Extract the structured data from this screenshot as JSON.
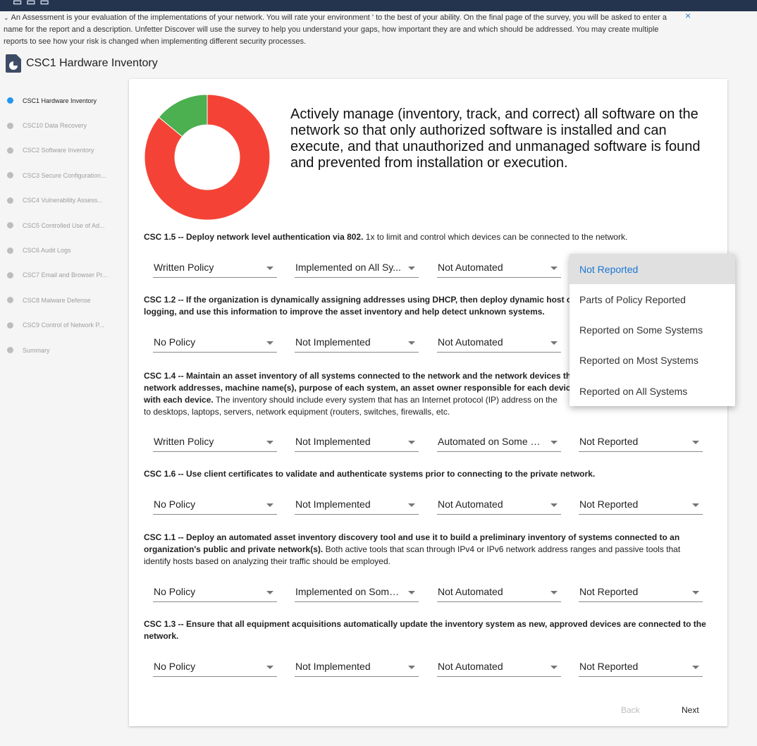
{
  "info_banner": {
    "text": "An Assessment is your evaluation of the implementations of your network. You will rate your environment ' to the best of your ability. On the final page of the survey, you will be asked to enter a name for the report and a description. Unfetter Discover will use the survey to help you understand your gaps, how important they are and which should be addressed. You may create multiple reports to see how your risk is changed when implementing different security processes.",
    "close": "×"
  },
  "page_title": "CSC1 Hardware Inventory",
  "sidebar": {
    "items": [
      {
        "label": "CSC1 Hardware Inventory"
      },
      {
        "label": "CSC10 Data Recovery"
      },
      {
        "label": "CSC2 Software Inventory"
      },
      {
        "label": "CSC3 Secure Configuration..."
      },
      {
        "label": "CSC4 Vulnerability Assess..."
      },
      {
        "label": "CSC5 Controlled Use of Ad..."
      },
      {
        "label": "CSC6 Audit Logs"
      },
      {
        "label": "CSC7 Email and Browser Pr..."
      },
      {
        "label": "CSC8 Malware Defense"
      },
      {
        "label": "CSC9 Control of Network P..."
      },
      {
        "label": "Summary"
      }
    ]
  },
  "colors": {
    "accent": "#2196f3",
    "donut_red": "#f44336",
    "donut_green": "#4caf50",
    "header": "#24344f"
  },
  "chart_data": {
    "type": "pie",
    "values": [
      86,
      14
    ]
  },
  "goal_text": "Actively manage (inventory, track, and correct) all software on the network so that only authorized software is installed and can execute, and that unauthorized and unmanaged software is found and prevented from installation or execution.",
  "questions": [
    {
      "bold": "CSC 1.5 -- Deploy network level authentication via 802.",
      "rest": " 1x to limit and control which devices can be connected to the network.",
      "answers": [
        "Written Policy",
        "Implemented on All Sy...",
        "Not Automated",
        ""
      ]
    },
    {
      "bold": "CSC 1.2 -- If the organization is dynamically assigning addresses using DHCP, then deploy dynamic host co",
      "bold2": "logging, and use this information to improve the asset inventory and help detect unknown systems.",
      "answers": [
        "No Policy",
        "Not Implemented",
        "Not Automated",
        ""
      ]
    },
    {
      "bold": "CSC 1.4 -- Maintain an asset inventory of all systems connected to the network and the network devices th",
      "bold2": "network addresses, machine name(s), purpose of each system, an asset owner responsible for each device",
      "bold3": "with each device.",
      "rest3": " The inventory should include every system that has an Internet protocol (IP) address on the",
      "rest4": "to desktops, laptops, servers, network equipment (routers, switches, firewalls, etc.",
      "answers": [
        "Written Policy",
        "Not Implemented",
        "Automated on Some S...",
        "Not Reported"
      ]
    },
    {
      "bold": "CSC 1.6 -- Use client certificates to validate and authenticate systems prior to connecting to the private network.",
      "answers": [
        "No Policy",
        "Not Implemented",
        "Not Automated",
        "Not Reported"
      ]
    },
    {
      "bold": "CSC 1.1 -- Deploy an automated asset inventory discovery tool and use it to build a preliminary inventory of systems connected to an organization's public and private network(s).",
      "rest": " Both active tools that scan through IPv4 or IPv6 network address ranges and passive tools that identify hosts based on analyzing their traffic should be employed.",
      "answers": [
        "No Policy",
        "Implemented on Some ...",
        "Not Automated",
        "Not Reported"
      ]
    },
    {
      "bold": "CSC 1.3 -- Ensure that all equipment acquisitions automatically update the inventory system as new, approved devices are connected to the network.",
      "answers": [
        "No Policy",
        "Not Implemented",
        "Not Automated",
        "Not Reported"
      ]
    }
  ],
  "dropdown_menu": {
    "options": [
      "Not Reported",
      "Parts of Policy Reported",
      "Reported on Some Systems",
      "Reported on Most Systems",
      "Reported on All Systems"
    ]
  },
  "nav": {
    "back": "Back",
    "next": "Next"
  }
}
